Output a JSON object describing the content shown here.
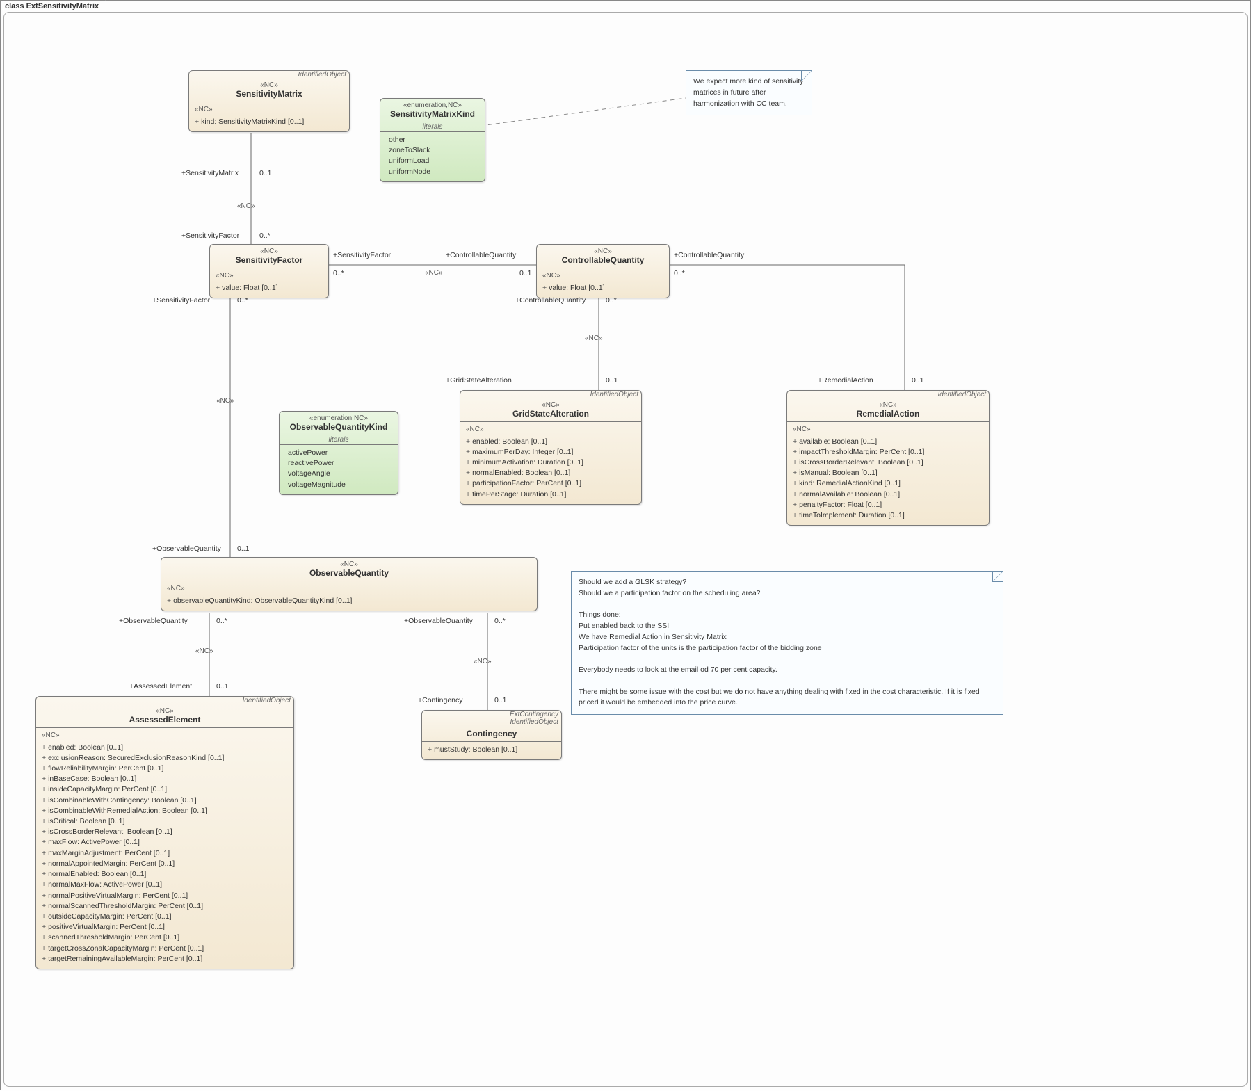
{
  "frame_title": "class ExtSensitivityMatrix",
  "notes": {
    "n1": "We expect more kind of sensitivity matrices in future after harmonization with CC team.",
    "n2": "Should we add a GLSK strategy?\nShould we a  participation factor on the scheduling area?\n\nThings done:\nPut enabled back to the SSI\nWe have Remedial Action in Sensitivity Matrix\nParticipation factor of the units is the participation factor of the bidding zone\n\nEverybody needs to look at the email od 70 per cent capacity.\n\nThere might be some issue with the cost but we do not have anything dealing with fixed in the cost characteristic. If it is fixed priced it would be embedded into the price curve."
  },
  "classes": {
    "SensitivityMatrix": {
      "super": "IdentifiedObject",
      "stereo": "«NC»",
      "name": "SensitivityMatrix",
      "body_stereo": "«NC»",
      "attrs": [
        "kind: SensitivityMatrixKind [0..1]"
      ]
    },
    "SensitivityMatrixKind": {
      "stereo": "«enumeration,NC»",
      "name": "SensitivityMatrixKind",
      "section": "literals",
      "literals": [
        "other",
        "zoneToSlack",
        "uniformLoad",
        "uniformNode"
      ]
    },
    "SensitivityFactor": {
      "stereo": "«NC»",
      "name": "SensitivityFactor",
      "body_stereo": "«NC»",
      "attrs": [
        "value: Float [0..1]"
      ]
    },
    "ControllableQuantity": {
      "stereo": "«NC»",
      "name": "ControllableQuantity",
      "body_stereo": "«NC»",
      "attrs": [
        "value: Float [0..1]"
      ]
    },
    "GridStateAlteration": {
      "super": "IdentifiedObject",
      "stereo": "«NC»",
      "name": "GridStateAlteration",
      "body_stereo": "«NC»",
      "attrs": [
        "enabled: Boolean [0..1]",
        "maximumPerDay: Integer [0..1]",
        "minimumActivation: Duration [0..1]",
        "normalEnabled: Boolean [0..1]",
        "participationFactor: PerCent [0..1]",
        "timePerStage: Duration [0..1]"
      ]
    },
    "RemedialAction": {
      "super": "IdentifiedObject",
      "stereo": "«NC»",
      "name": "RemedialAction",
      "body_stereo": "«NC»",
      "attrs": [
        "available: Boolean [0..1]",
        "impactThresholdMargin: PerCent [0..1]",
        "isCrossBorderRelevant: Boolean [0..1]",
        "isManual: Boolean [0..1]",
        "kind: RemedialActionKind [0..1]",
        "normalAvailable: Boolean [0..1]",
        "penaltyFactor: Float [0..1]",
        "timeToImplement: Duration [0..1]"
      ]
    },
    "ObservableQuantityKind": {
      "stereo": "«enumeration,NC»",
      "name": "ObservableQuantityKind",
      "section": "literals",
      "literals": [
        "activePower",
        "reactivePower",
        "voltageAngle",
        "voltageMagnitude"
      ]
    },
    "ObservableQuantity": {
      "stereo": "«NC»",
      "name": "ObservableQuantity",
      "body_stereo": "«NC»",
      "attrs": [
        "observableQuantityKind: ObservableQuantityKind [0..1]"
      ]
    },
    "AssessedElement": {
      "super": "IdentifiedObject",
      "stereo": "«NC»",
      "name": "AssessedElement",
      "body_stereo": "«NC»",
      "attrs": [
        "enabled: Boolean [0..1]",
        "exclusionReason: SecuredExclusionReasonKind [0..1]",
        "flowReliabilityMargin: PerCent [0..1]",
        "inBaseCase: Boolean [0..1]",
        "insideCapacityMargin: PerCent [0..1]",
        "isCombinableWithContingency: Boolean [0..1]",
        "isCombinableWithRemedialAction: Boolean [0..1]",
        "isCritical: Boolean [0..1]",
        "isCrossBorderRelevant: Boolean [0..1]",
        "maxFlow: ActivePower [0..1]",
        "maxMarginAdjustment: PerCent [0..1]",
        "normalAppointedMargin: PerCent [0..1]",
        "normalEnabled: Boolean [0..1]",
        "normalMaxFlow: ActivePower [0..1]",
        "normalPositiveVirtualMargin: PerCent [0..1]",
        "normalScannedThresholdMargin: PerCent [0..1]",
        "outsideCapacityMargin: PerCent [0..1]",
        "positiveVirtualMargin: PerCent [0..1]",
        "scannedThresholdMargin: PerCent [0..1]",
        "targetCrossZonalCapacityMargin: PerCent [0..1]",
        "targetRemainingAvailableMargin: PerCent [0..1]"
      ]
    },
    "Contingency": {
      "super": "ExtContingency\nIdentifiedObject",
      "name": "Contingency",
      "attrs": [
        "mustStudy: Boolean [0..1]"
      ]
    }
  },
  "assoc": {
    "sm_sf_top": "+SensitivityMatrix",
    "sm_sf_top_m": "0..1",
    "sm_sf_bot": "+SensitivityFactor",
    "sm_sf_bot_m": "0..*",
    "sf_cq_l": "+SensitivityFactor",
    "sf_cq_l_m": "0..*",
    "sf_cq_r": "+ControllableQuantity",
    "sf_cq_r_m": "0..1",
    "sf_oq_top": "+SensitivityFactor",
    "sf_oq_top_m": "0..*",
    "sf_oq_bot": "+ObservableQuantity",
    "sf_oq_bot_m": "0..1",
    "cq_gsa_top": "+ControllableQuantity",
    "cq_gsa_top_m": "0..*",
    "cq_gsa_bot": "+GridStateAlteration",
    "cq_gsa_bot_m": "0..1",
    "cq_ra_l": "+ControllableQuantity",
    "cq_ra_l_m": "0..*",
    "cq_ra_r": "+RemedialAction",
    "cq_ra_r_m": "0..1",
    "oq_ae_top": "+ObservableQuantity",
    "oq_ae_top_m": "0..*",
    "oq_ae_bot": "+AssessedElement",
    "oq_ae_bot_m": "0..1",
    "oq_ct_top": "+ObservableQuantity",
    "oq_ct_top_m": "0..*",
    "oq_ct_bot": "+Contingency",
    "oq_ct_bot_m": "0..1",
    "nc": "«NC»"
  }
}
